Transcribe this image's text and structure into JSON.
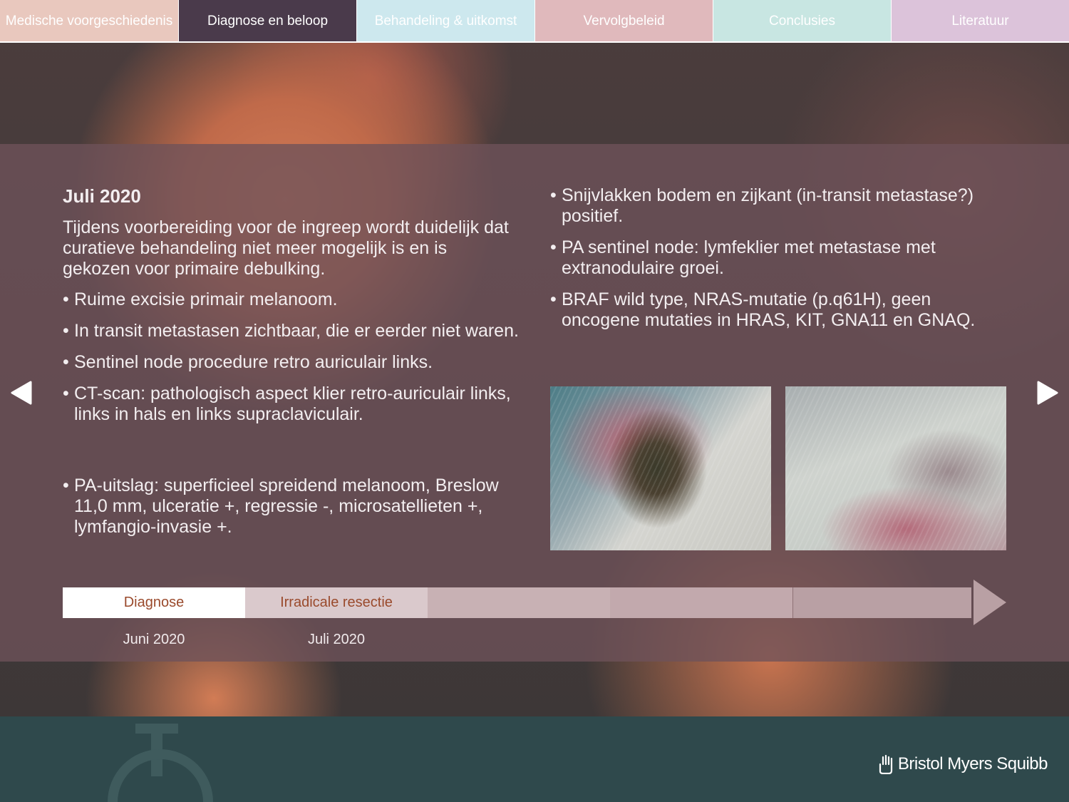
{
  "nav": {
    "tabs": [
      {
        "label": "Medische voorgeschiedenis",
        "color": "#e9c8be"
      },
      {
        "label": "Diagnose en beloop",
        "color": "#4a3a4b",
        "active": true
      },
      {
        "label": "Behandeling & uitkomst",
        "color": "#cde8ee"
      },
      {
        "label": "Vervolgbeleid",
        "color": "#e0b9bc"
      },
      {
        "label": "Conclusies",
        "color": "#c8e6e2"
      },
      {
        "label": "Literatuur",
        "color": "#dcc3da"
      }
    ]
  },
  "content": {
    "heading": "Juli 2020",
    "intro": "Tijdens voorbereiding voor de ingreep wordt duidelijk dat curatieve behandeling niet meer mogelijk is en is gekozen voor primaire debulking.",
    "left_bullets": [
      "Ruime excisie primair melanoom.",
      "In transit metastasen zichtbaar, die er eerder niet waren.",
      "Sentinel node procedure retro auriculair links.",
      "CT-scan: pathologisch aspect klier retro-auriculair links, links in hals en links supraclaviculair."
    ],
    "pa_bullet": "PA-uitslag: superficieel spreidend melanoom, Breslow 11,0 mm, ulceratie +,  regressie -, microsatellieten +, lymfangio-invasie +.",
    "right_bullets": [
      "Snijvlakken bodem en zijkant (in-transit metastase?) positief.",
      "PA sentinel node: lymfeklier met metastase met extranodulaire groei.",
      "BRAF wild type, NRAS-mutatie (p.q61H), geen oncogene mutaties in HRAS, KIT, GNA11 en GNAQ."
    ]
  },
  "timeline": {
    "steps": [
      {
        "label": "Diagnose",
        "date": "Juni 2020"
      },
      {
        "label": "Irradicale resectie",
        "date": "Juli 2020"
      },
      {
        "label": "",
        "date": ""
      },
      {
        "label": "",
        "date": ""
      },
      {
        "label": "",
        "date": ""
      }
    ]
  },
  "controls": {
    "prev_icon": "triangle-left-icon",
    "next_icon": "triangle-right-icon"
  },
  "footer": {
    "logo_text": "Bristol Myers Squibb",
    "logo_icon": "hand-icon"
  }
}
